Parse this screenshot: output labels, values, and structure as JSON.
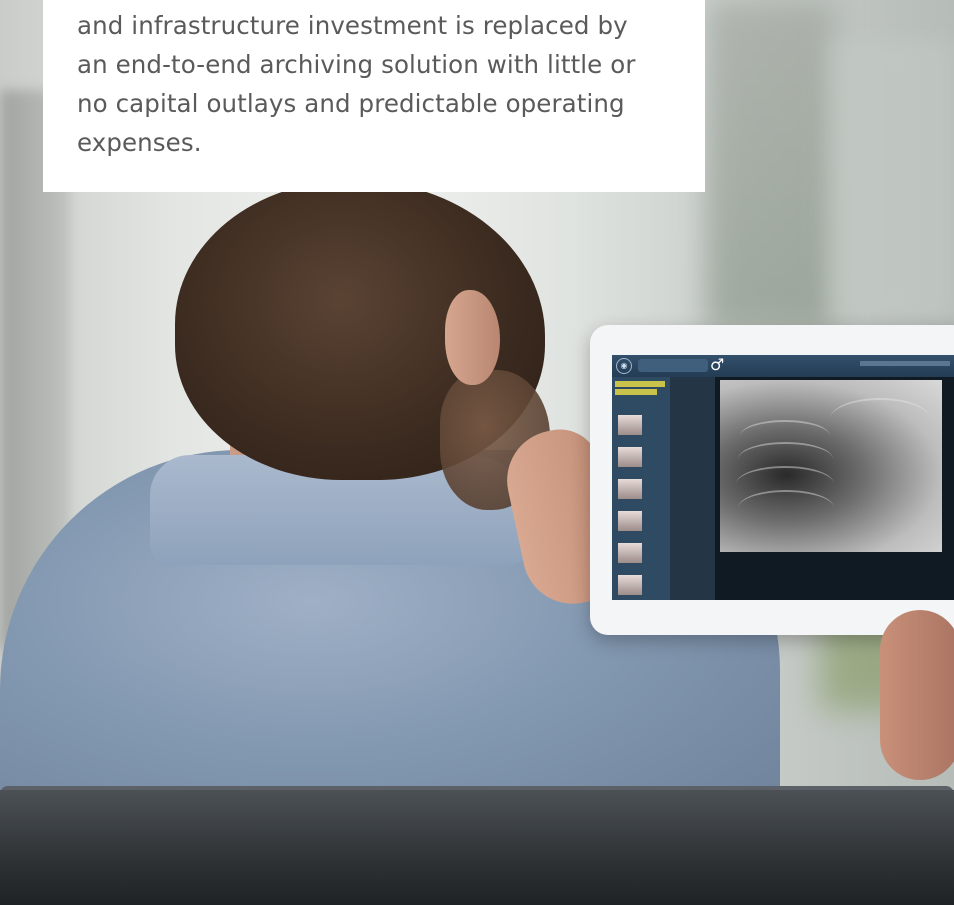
{
  "text_box": {
    "lines": [
      "and infrastructure investment is replaced by",
      "an end-to-end archiving solution with little or",
      "no capital outlays and predictable operating",
      "expenses."
    ]
  },
  "colors": {
    "text_box_bg": "#ffffff",
    "text_color": "#5a5a5a",
    "shirt": "#8398b1",
    "sofa": "#2f3336"
  },
  "icons": {
    "tablet_home": "circle-logo-icon",
    "tablet_gender": "male-symbol-icon"
  }
}
